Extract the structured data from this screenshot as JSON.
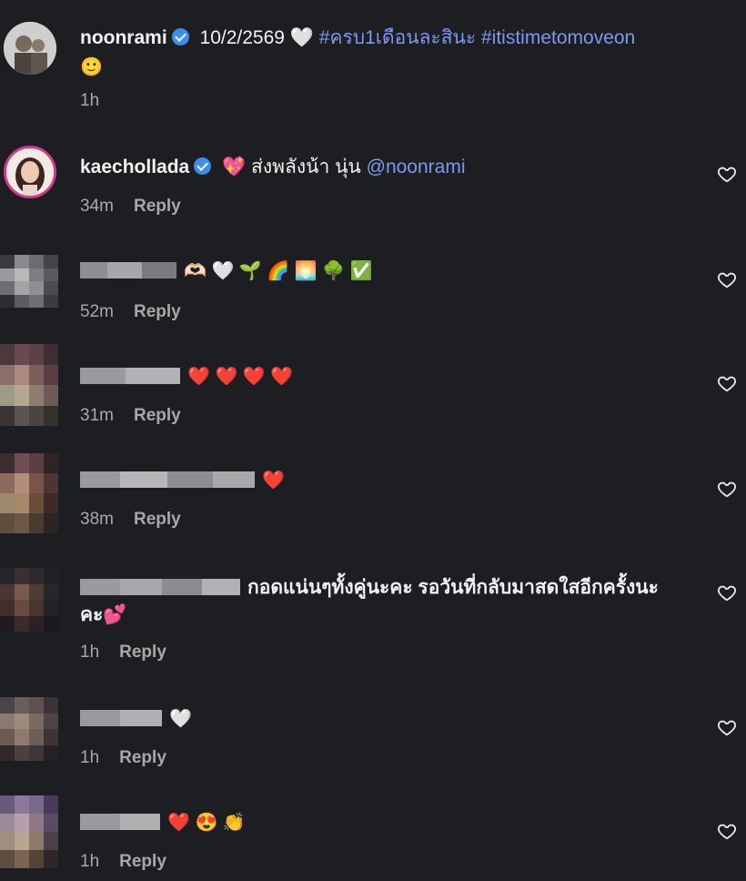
{
  "post": {
    "username": "noonrami",
    "text": "10/2/2569 🤍",
    "hashtags": "#ครบ1เดือนละสินะ #itistimetomoveon",
    "emoji_line": "🙂",
    "time": "1h"
  },
  "comments": [
    {
      "username": "kaechollada",
      "text": "💖  ส่งพลังน้า นุ่น ",
      "mention": "@noonrami",
      "time": "34m",
      "reply": "Reply"
    },
    {
      "username": "",
      "text": "🫶🏻 🤍 🌱 🌈 🌅 🌳 ✅",
      "time": "52m",
      "reply": "Reply"
    },
    {
      "username": "",
      "text": "❤️ ❤️ ❤️ ❤️",
      "time": "31m",
      "reply": "Reply"
    },
    {
      "username": "",
      "text": "❤️",
      "time": "38m",
      "reply": "Reply"
    },
    {
      "username": "",
      "text": "กอดแน่นๆทั้งคู่นะคะ รอวันที่กลับมาสดใสอีกครั้งนะ",
      "text2": "คะ💕",
      "time": "1h",
      "reply": "Reply"
    },
    {
      "username": "",
      "text": "🤍",
      "time": "1h",
      "reply": "Reply"
    },
    {
      "username": "",
      "text": "❤️ 😍 👏",
      "time": "1h",
      "reply": "Reply"
    }
  ],
  "colors": {
    "background": "#1d1e22",
    "link": "#7b98f3",
    "meta": "#a8a8a8",
    "verified": "#3a8ef0"
  },
  "icons": {
    "like": "heart-outline-icon",
    "verified": "verified-badge-icon"
  }
}
